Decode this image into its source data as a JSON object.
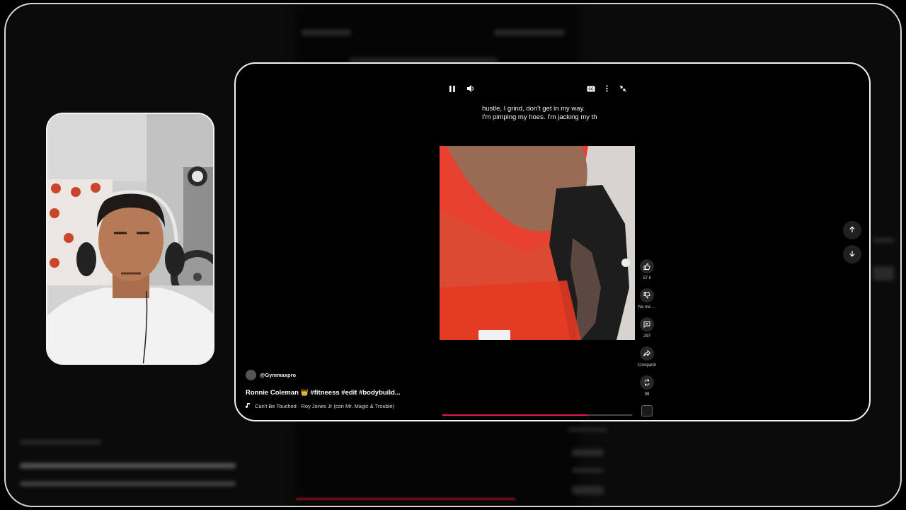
{
  "player": {
    "captions": {
      "line1": "hustle, I grind, don't get in my way.",
      "line2": "I'm pimping my hoes. I'm jacking my th"
    },
    "progress": 0.77
  },
  "icons": {
    "pause": "pause-icon",
    "volume": "volume-icon",
    "cc": "closed-captions-icon",
    "more": "more-vert-icon",
    "collapse": "collapse-icon",
    "like": "thumb-up-icon",
    "dislike": "thumb-down-icon",
    "comment": "comment-icon",
    "share": "share-icon",
    "remix": "remix-icon",
    "music": "music-note-icon",
    "up": "arrow-up-icon",
    "down": "arrow-down-icon"
  },
  "actions": {
    "like_count": "57 k",
    "dislike_label": "No me ...",
    "comments_count": "297",
    "share_label": "Compartir",
    "remix_count": "98"
  },
  "info": {
    "channel": "@Gymmaxpro",
    "title_name": "Ronnie Coleman",
    "title_crown": "👑",
    "title_tags": "#fitneess #edit #bodybuild...",
    "music": "Can't Be Touched · Roy Jones Jr (con Mr. Magic & Trouble)"
  },
  "colors": {
    "accent_progress": "#e0184c",
    "card_border": "#f2f2f2",
    "background": "#000000"
  }
}
